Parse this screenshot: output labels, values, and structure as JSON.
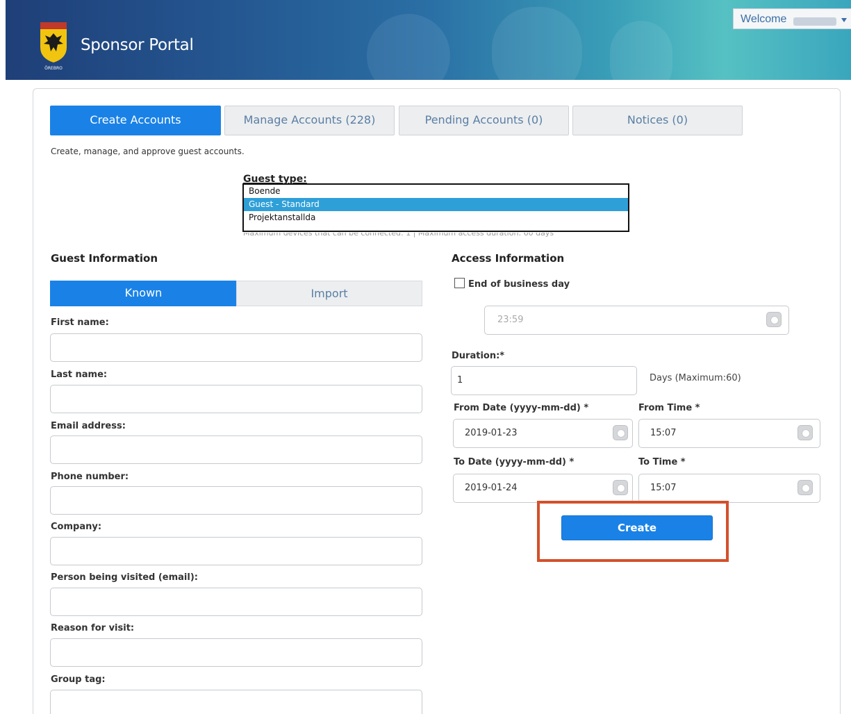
{
  "header": {
    "title": "Sponsor Portal",
    "welcome_label": "Welcome",
    "logo_caption": "ÖREBRO",
    "brand_gradient": [
      "#1f3f78",
      "#2a6fa5",
      "#56c1c3"
    ]
  },
  "tabs": [
    {
      "label": "Create Accounts",
      "active": true
    },
    {
      "label": "Manage Accounts (228)",
      "active": false
    },
    {
      "label": "Pending Accounts (0)",
      "active": false
    },
    {
      "label": "Notices (0)",
      "active": false
    }
  ],
  "subtitle": "Create, manage, and approve guest accounts.",
  "guest_type": {
    "label": "Guest type:",
    "options": [
      "Boende",
      "Guest - Standard",
      "Projektanstallda"
    ],
    "selected": "Guest - Standard",
    "hint": "Maximum devices that can be connected: 1   |   Maximum access duration: 60 days"
  },
  "guest_info": {
    "heading": "Guest Information",
    "toggle_known": "Known",
    "toggle_import": "Import",
    "fields": [
      {
        "label": "First name:",
        "value": ""
      },
      {
        "label": "Last name:",
        "value": ""
      },
      {
        "label": "Email address:",
        "value": ""
      },
      {
        "label": "Phone number:",
        "value": ""
      },
      {
        "label": "Company:",
        "value": ""
      },
      {
        "label": "Person being visited (email):",
        "value": ""
      },
      {
        "label": "Reason for visit:",
        "value": ""
      },
      {
        "label": "Group tag:",
        "value": ""
      }
    ]
  },
  "access_info": {
    "heading": "Access Information",
    "end_of_business_day_label": "End of business day",
    "end_of_business_day_checked": false,
    "end_time_value": "23:59",
    "duration_label": "Duration:*",
    "duration_value": "1",
    "duration_unit": "Days (Maximum:60)",
    "from_date_label": "From Date (yyyy-mm-dd) *",
    "from_date_value": "2019-01-23",
    "from_time_label": "From Time *",
    "from_time_value": "15:07",
    "to_date_label": "To Date (yyyy-mm-dd) *",
    "to_date_value": "2019-01-24",
    "to_time_label": "To Time *",
    "to_time_value": "15:07",
    "create_label": "Create"
  },
  "colors": {
    "primary": "#1a82e6",
    "highlight": "#d4502b",
    "selected_option": "#2f9fd8"
  }
}
